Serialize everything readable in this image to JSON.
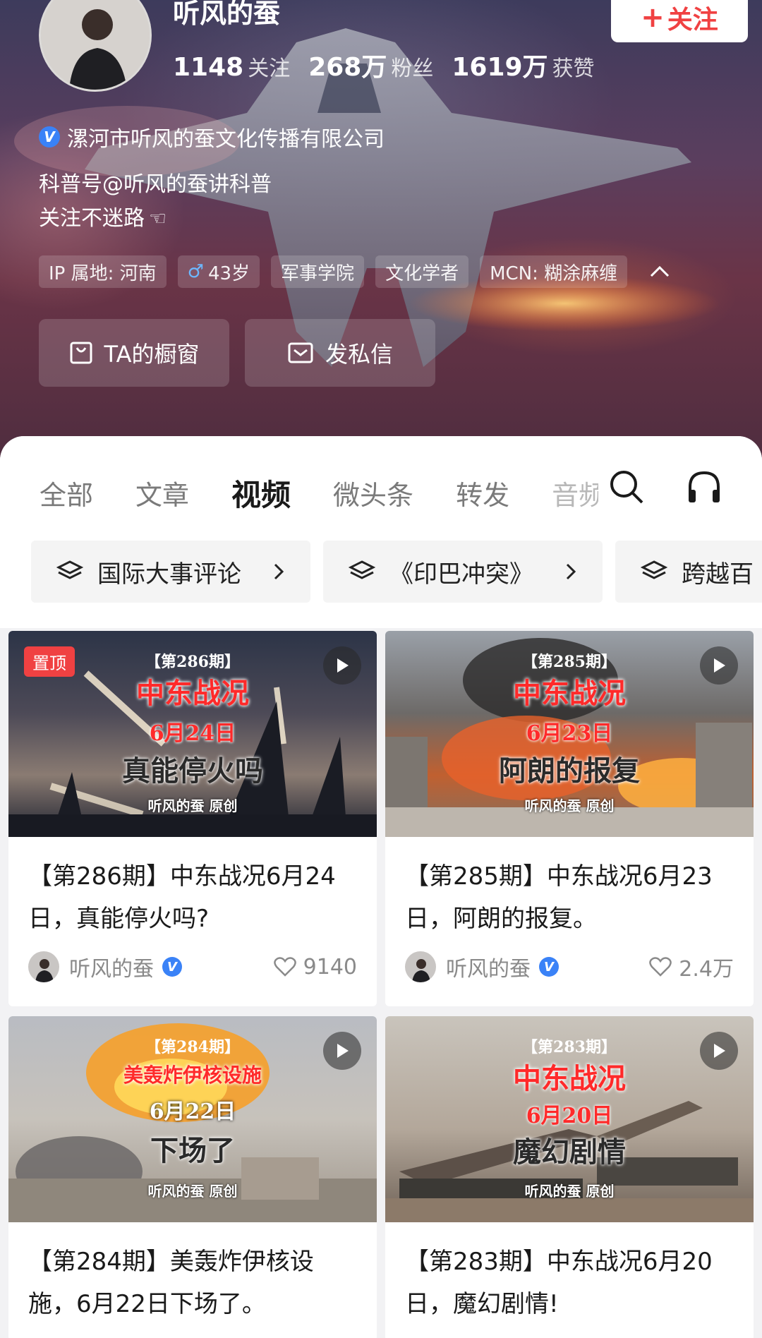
{
  "profile": {
    "name": "听风的蚕",
    "follow_label": "关注",
    "stats": [
      {
        "value": "1148",
        "label": "关注"
      },
      {
        "value": "268万",
        "label": "粉丝"
      },
      {
        "value": "1619万",
        "label": "获赞"
      }
    ],
    "verified_badge": "V",
    "verified_text": "漯河市听风的蚕文化传播有限公司",
    "bio_line1": "科普号@听风的蚕讲科普",
    "bio_line2": "关注不迷路",
    "tags": {
      "ip": "IP 属地: 河南",
      "age": "43岁",
      "school": "军事学院",
      "title": "文化学者",
      "mcn": "MCN: 糊涂麻缠"
    },
    "shop_button": "TA的橱窗",
    "message_button": "发私信"
  },
  "tabs": {
    "all": "全部",
    "article": "文章",
    "video": "视频",
    "micro": "微头条",
    "repost": "转发",
    "audio": "音频"
  },
  "collections": [
    "国际大事评论",
    "《印巴冲突》",
    "跨越百"
  ],
  "videos": [
    {
      "pinned": "置顶",
      "thumb_issue": "【第286期】",
      "thumb_headline": "中东战况",
      "thumb_date": "6月24日",
      "thumb_sub": "真能停火吗",
      "thumb_sign": "听风的蚕  原创",
      "title": "【第286期】中东战况6月24日，真能停火吗?",
      "author": "听风的蚕",
      "likes": "9140"
    },
    {
      "thumb_issue": "【第285期】",
      "thumb_headline": "中东战况",
      "thumb_date": "6月23日",
      "thumb_sub": "阿朗的报复",
      "thumb_sign": "听风的蚕  原创",
      "title": "【第285期】中东战况6月23日，阿朗的报复。",
      "author": "听风的蚕",
      "likes": "2.4万"
    },
    {
      "thumb_issue": "【第284期】",
      "thumb_headline": "美轰炸伊核设施",
      "thumb_date": "6月22日",
      "thumb_sub": "下场了",
      "thumb_sign": "听风的蚕  原创",
      "title": "【第284期】美轰炸伊核设施，6月22日下场了。"
    },
    {
      "thumb_issue": "【第283期】",
      "thumb_headline": "中东战况",
      "thumb_date": "6月20日",
      "thumb_sub": "魔幻剧情",
      "thumb_sign": "听风的蚕  原创",
      "title": "【第283期】中东战况6月20日，魔幻剧情!"
    }
  ],
  "colors": {
    "accent_red": "#f04142",
    "verified_blue": "#3a82f7"
  }
}
